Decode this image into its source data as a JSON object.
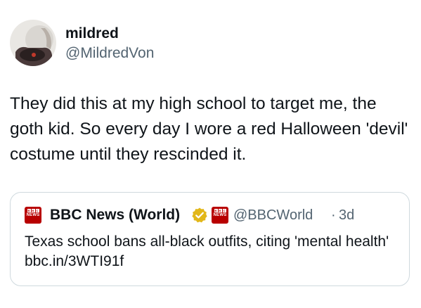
{
  "tweet": {
    "author": {
      "display_name": "mildred",
      "handle": "@MildredVon"
    },
    "text": "They did this at my high school to target me, the goth kid. So every day I wore a red Halloween 'devil' costume until they rescinded it."
  },
  "quote": {
    "author": {
      "display_name": "BBC News (World)",
      "handle": "@BBCWorld",
      "verified_icon": "verified-gold-badge-icon",
      "logo_icon": "bbc-news-logo-icon",
      "logo_letters": [
        "B",
        "B",
        "C"
      ],
      "logo_text": "NEWS"
    },
    "separator": "·",
    "time": "3d",
    "text": "Texas school bans all-black outfits, citing 'mental health' bbc.in/3WTI91f"
  },
  "colors": {
    "text_primary": "#0f1419",
    "text_secondary": "#536471",
    "border": "#cfd9de",
    "verified_gold": "#e2b719",
    "bbc_red": "#b80000"
  }
}
